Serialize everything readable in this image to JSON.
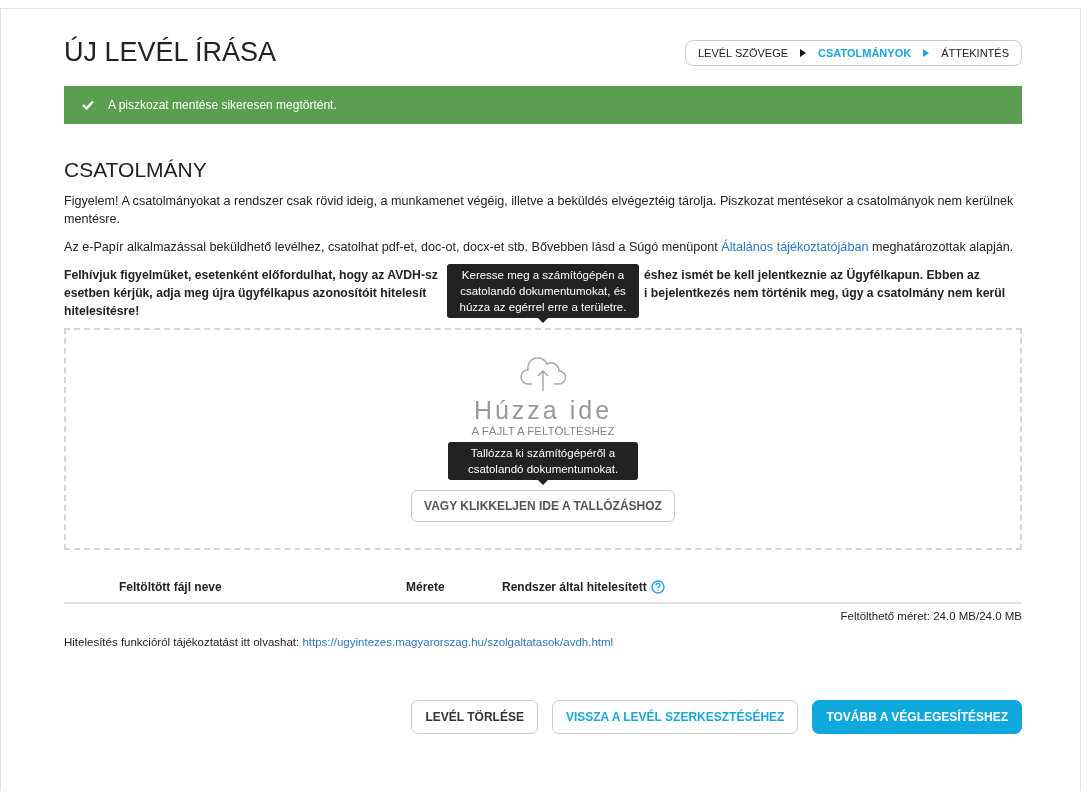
{
  "title": "ÚJ LEVÉL ÍRÁSA",
  "steps": [
    {
      "label": "LEVÉL SZÖVEGE",
      "selected": false
    },
    {
      "label": "CSATOLMÁNYOK",
      "selected": true
    },
    {
      "label": "ÁTTEKINTÉS",
      "selected": false
    }
  ],
  "alert": {
    "kind": "success",
    "text": "A piszkozat mentése sikeresen megtörtént."
  },
  "section_title": "CSATOLMÁNY",
  "notice": "Figyelem! A csatolmányokat a rendszer csak rövid ideig, a munkamenet végéig, illetve a beküldés elvégeztéig tárolja. Piszkozat mentésekor a csatolmányok nem kerülnek mentésre.",
  "info": {
    "before": "Az e-Papír alkalmazással beküldhető levélhez, csatolhat pdf-et, doc-ot, docx-et stb. Bővebben lásd a Súgó menüpont ",
    "link": "Általános tájékoztatójában",
    "after": " meghatározottak alapján."
  },
  "warning_lines": [
    {
      "left": "Felhívjuk figyelmüket, esetenként előfordulhat, hogy az AVDH-sz",
      "right": "éshez ismét be kell jelentkeznie az Ügyfélkapun. Ebben az"
    },
    {
      "left": "esetben kérjük, adja meg újra ügyfélkapus azonosítóit hitelesít",
      "right": "i bejelentkezés nem történik meg, úgy a csatolmány nem kerül"
    },
    {
      "left": "hitelesítésre!"
    }
  ],
  "tooltip_drop": "Keresse meg a számítógépén a csatolandó dokumentumokat, és húzza az egérrel erre a területre.",
  "dropzone": {
    "title": "Húzza ide",
    "subtitle": "A FÁJLT A FELTÖLTÉSHEZ",
    "tooltip": "Tallózza ki számítógépéről a csatolandó dokumentumokat.",
    "button": "VAGY KLIKKELJEN IDE A TALLÓZÁSHOZ"
  },
  "table": {
    "columns": [
      "Feltöltött fájl neve",
      "Mérete",
      "Rendszer által hitelesített"
    ]
  },
  "quota": "Feltölthető méret: 24.0 MB/24.0 MB",
  "auth_info": {
    "text": "Hitelesítés funkcióról tájékoztatást itt olvashat:",
    "link": "https://ugyintezes.magyarorszag.hu/szolgaltatasok/avdh.html"
  },
  "buttons": [
    {
      "label": "LEVÉL TÖRLÉSE",
      "kind": "default"
    },
    {
      "label": "VISSZA A LEVÉL SZERKESZTÉSÉHEZ",
      "kind": "secondary"
    },
    {
      "label": "TOVÁBB A VÉGLEGESÍTÉSHEZ",
      "kind": "primary"
    }
  ]
}
